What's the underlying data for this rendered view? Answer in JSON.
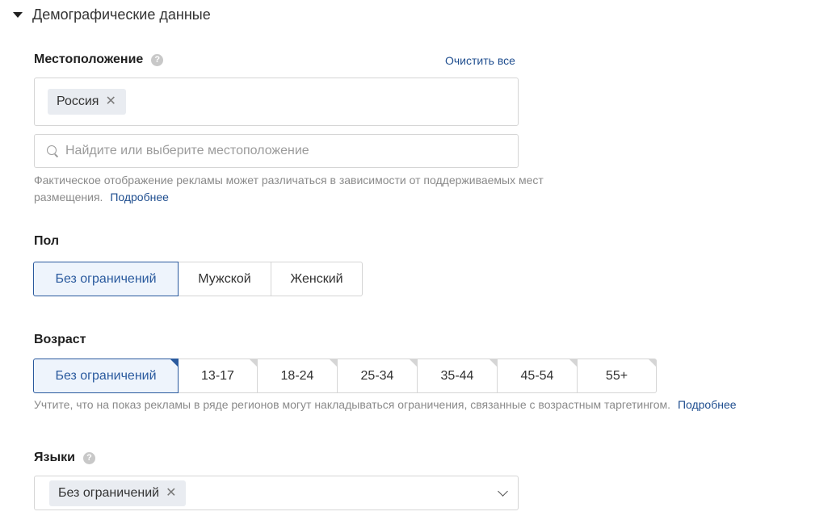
{
  "section": {
    "title": "Демографические данные"
  },
  "location": {
    "label": "Местоположение",
    "help_icon": "question-icon",
    "clear_all": "Очистить все",
    "selected": [
      {
        "label": "Россия",
        "remove": "✕"
      }
    ],
    "search_placeholder": "Найдите или выберите местоположение",
    "hint_text": "Фактическое отображение рекламы может различаться в зависимости от поддерживаемых мест",
    "hint_text_2": "размещения.",
    "hint_link": "Подробнее"
  },
  "gender": {
    "label": "Пол",
    "options": [
      "Без ограничений",
      "Мужской",
      "Женский"
    ],
    "selected": "Без ограничений"
  },
  "age": {
    "label": "Возраст",
    "options": [
      "Без ограничений",
      "13-17",
      "18-24",
      "25-34",
      "35-44",
      "45-54",
      "55+"
    ],
    "selected": "Без ограничений",
    "hint_text": "Учтите, что на показ рекламы в ряде регионов могут накладываться ограничения, связанные с возрастным таргетингом.",
    "hint_link": "Подробнее"
  },
  "languages": {
    "label": "Языки",
    "help_icon": "question-icon",
    "selected": [
      {
        "label": "Без ограничений",
        "remove": "✕"
      }
    ],
    "dropdown_icon": "chevron-down-icon"
  }
}
